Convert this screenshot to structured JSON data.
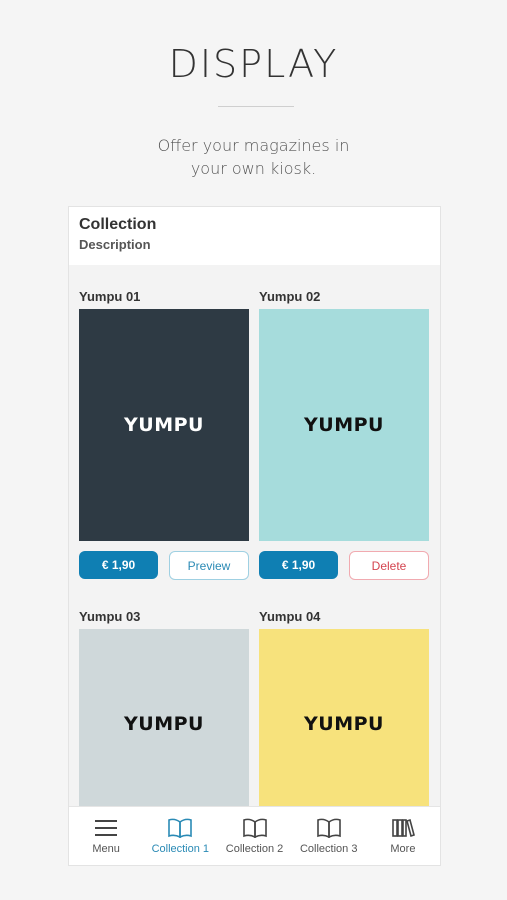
{
  "hero": {
    "title": "DISPLAY",
    "subtitle": "Offer your magazines in\nyour own kiosk."
  },
  "collection": {
    "title": "Collection",
    "description": "Description"
  },
  "items": [
    {
      "title": "Yumpu 01",
      "cover_text": "YUMPU",
      "cover_color": "#2e3a44",
      "text_color": "#ffffff",
      "price": "€ 1,90",
      "action": "Preview"
    },
    {
      "title": "Yumpu 02",
      "cover_text": "YUMPU",
      "cover_color": "#a6dcdc",
      "text_color": "#111111",
      "price": "€ 1,90",
      "action": "Delete"
    },
    {
      "title": "Yumpu 03",
      "cover_text": "YUMPU",
      "cover_color": "#cfd8da",
      "text_color": "#111111"
    },
    {
      "title": "Yumpu 04",
      "cover_text": "YUMPU",
      "cover_color": "#f7e27c",
      "text_color": "#111111"
    }
  ],
  "tabs": [
    {
      "label": "Menu",
      "icon": "menu-icon"
    },
    {
      "label": "Collection 1",
      "icon": "book-icon",
      "active": true
    },
    {
      "label": "Collection 2",
      "icon": "book-icon"
    },
    {
      "label": "Collection 3",
      "icon": "book-icon"
    },
    {
      "label": "More",
      "icon": "library-icon"
    }
  ],
  "colors": {
    "accent": "#0f7fb3",
    "delete": "#d4444f"
  }
}
